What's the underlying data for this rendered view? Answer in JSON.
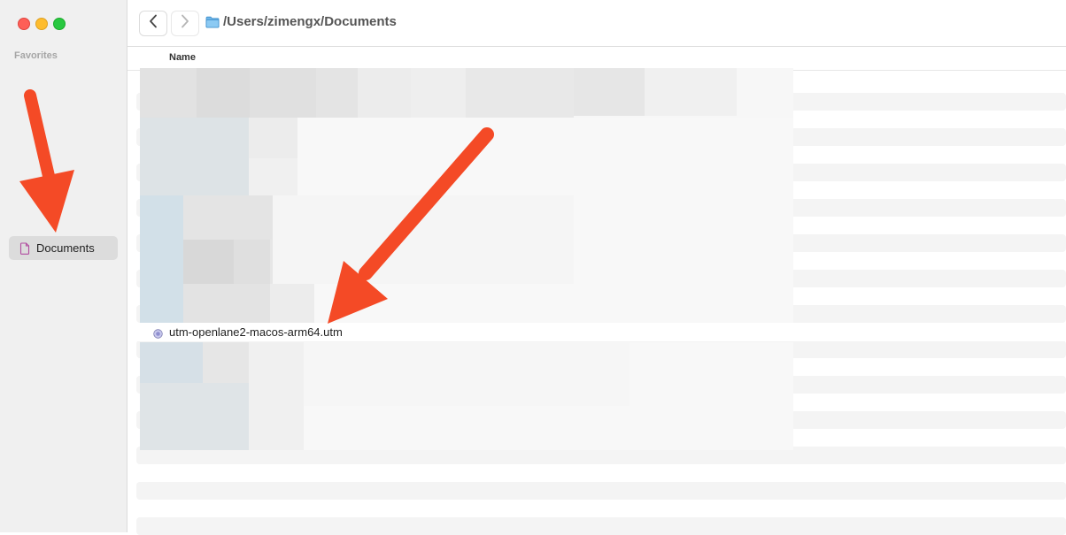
{
  "window": {
    "traffic_lights": [
      "close",
      "minimize",
      "zoom"
    ]
  },
  "sidebar": {
    "section_label": "Favorites",
    "items": [
      {
        "label": "Documents",
        "icon": "document-icon",
        "selected": true
      }
    ]
  },
  "toolbar": {
    "back_icon": "chevron-left-icon",
    "forward_icon": "chevron-right-icon",
    "folder_icon": "folder-icon",
    "path": "/Users/zimengx/Documents"
  },
  "list": {
    "column_header": "Name",
    "visible_file": {
      "name": "utm-openlane2-macos-arm64.utm",
      "icon": "utm-file-icon"
    }
  },
  "colors": {
    "annotation_arrow": "#f44a26",
    "sidebar_bg": "#f0f0f0",
    "selected_bg": "#dcdcdc",
    "stripe": "#f4f4f4"
  }
}
